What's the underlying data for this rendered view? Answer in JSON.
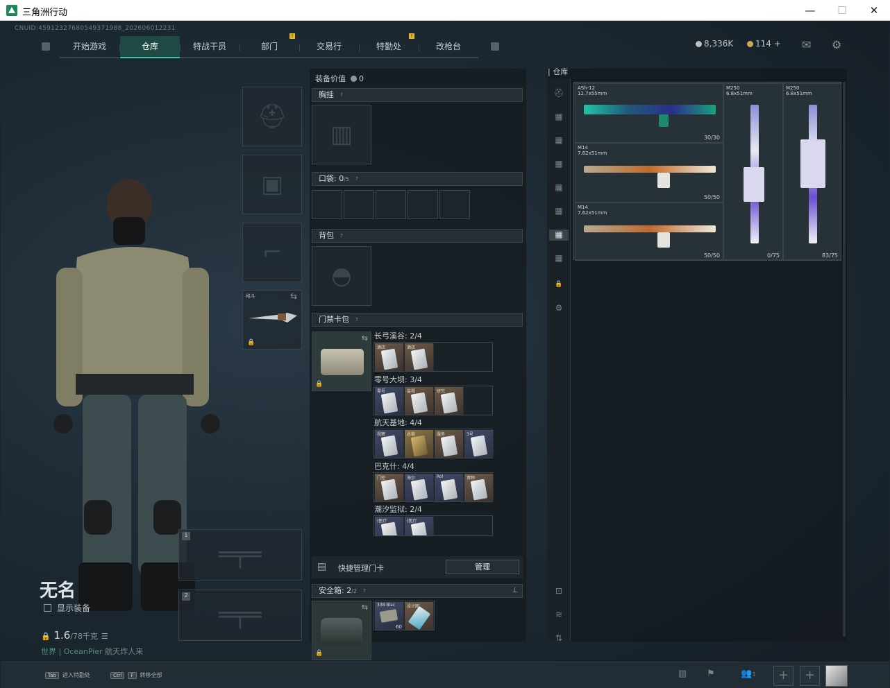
{
  "window": {
    "title": "三角洲行动",
    "min": "—",
    "max": "☐",
    "close": "✕"
  },
  "uid": "CNUID:4591232768054937​1988_202606012231",
  "nav": {
    "tabs": [
      {
        "label": "开始游戏"
      },
      {
        "label": "仓库",
        "active": true
      },
      {
        "label": "特战干员"
      },
      {
        "label": "部门"
      },
      {
        "label": "交易行",
        "badge": "!"
      },
      {
        "label": "特勤处"
      },
      {
        "label": "改枪台",
        "badge": "!"
      }
    ]
  },
  "currency": {
    "money": "8,336K",
    "coins": "114",
    "coin_plus": "+",
    "money_color": "#b8bfc4",
    "coin_color": "#d1a65a"
  },
  "player": {
    "name": "无名",
    "show_equipment": "显示装备",
    "weight": "1.6",
    "weight_max": "/78千克",
    "world": "世界",
    "world_name": "OceanPier",
    "world_suffix": "航天炸人来"
  },
  "loadout": {
    "melee_label": "格斗"
  },
  "weapon_slots": [
    {
      "num": "1"
    },
    {
      "num": "2"
    }
  ],
  "middle": {
    "equipment_value_label": "装备价值",
    "equipment_value": "0",
    "chest_rig": "胸挂",
    "pockets": "口袋:",
    "pockets_count": "0",
    "pockets_max": "/5",
    "backpack": "背包",
    "keycard_case": "门禁卡包",
    "maps": [
      {
        "name": "长弓溪谷: 2/4",
        "cards": [
          "酒店",
          "酒店"
        ]
      },
      {
        "name": "零号大坝: 3/4",
        "cards": [
          "零号",
          "监视",
          "研究"
        ]
      },
      {
        "name": "航天基地: 4/4",
        "cards": [
          "视察",
          "总裁",
          "服务",
          "3号"
        ]
      },
      {
        "name": "巴克什: 4/4",
        "cards": [
          "门控",
          "海尔",
          "Rol",
          "博物"
        ]
      },
      {
        "name": "潮汐监狱: 2/4",
        "cards": [
          "(医疗",
          "(医疗"
        ]
      }
    ],
    "quick_manage": "快捷管理门卡",
    "manage_btn": "管理",
    "safe_box": "安全箱:",
    "safe_count": "2",
    "safe_max": "/2",
    "safe_items": [
      {
        "label": "338 Blac",
        "count": "60"
      },
      {
        "label": "设计图"
      }
    ]
  },
  "warehouse": {
    "title": "仓库",
    "items": [
      {
        "name": "ASh-12",
        "caliber": "12.7x55mm",
        "ammo": "30/30"
      },
      {
        "name": "M14",
        "caliber": "7.62x51mm",
        "ammo": "50/50"
      },
      {
        "name": "M14",
        "caliber": "7.62x51mm",
        "ammo": "50/50"
      },
      {
        "name": "M250",
        "caliber": "6.8x51mm",
        "ammo": "0/75"
      },
      {
        "name": "M250",
        "caliber": "6.8x51mm",
        "ammo": "83/75"
      }
    ]
  },
  "bottom": {
    "hint1": "进入特勤处",
    "hint2": "转移全部",
    "key_tab": "Tab",
    "key_ctrl": "Ctrl",
    "key_f": "F",
    "friends_count": "1"
  },
  "colors": {
    "accent": "#38c79a",
    "badge": "#e8b629"
  },
  "icons": [
    "gear-icon",
    "mail-icon",
    "lock-icon",
    "swap-icon",
    "stats-icon",
    "flag-icon",
    "friends-icon",
    "plus-icon",
    "pin-icon"
  ]
}
